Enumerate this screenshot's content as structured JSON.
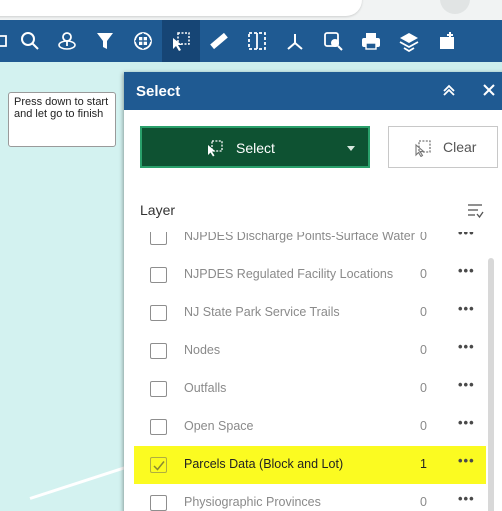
{
  "toolbar": {
    "icons": [
      "search-location-icon",
      "map-pin-icon",
      "filter-icon",
      "grid-icon",
      "select-icon",
      "ruler-icon",
      "split-icon",
      "coordinate-icon",
      "layer-search-icon",
      "print-icon",
      "layers-icon",
      "add-data-icon"
    ],
    "active_index": 4,
    "color": "#1f5a92"
  },
  "tooltip": {
    "text": "Press down to start and let go to finish"
  },
  "panel": {
    "title": "Select",
    "select_label": "Select",
    "clear_label": "Clear",
    "layer_heading": "Layer"
  },
  "layers": [
    {
      "label": "NJPDES Discharge Points-Surface Water",
      "count": "0",
      "checked": false
    },
    {
      "label": "NJPDES Regulated Facility Locations",
      "count": "0",
      "checked": false
    },
    {
      "label": "NJ State Park Service Trails",
      "count": "0",
      "checked": false
    },
    {
      "label": "Nodes",
      "count": "0",
      "checked": false
    },
    {
      "label": "Outfalls",
      "count": "0",
      "checked": false
    },
    {
      "label": "Open Space",
      "count": "0",
      "checked": false
    },
    {
      "label": "Parcels Data (Block and Lot)",
      "count": "1",
      "checked": true
    },
    {
      "label": "Physiographic Provinces",
      "count": "0",
      "checked": false
    }
  ],
  "more_label": "•••",
  "colors": {
    "select_green": "#0e5232",
    "highlight": "#fbfb21"
  }
}
